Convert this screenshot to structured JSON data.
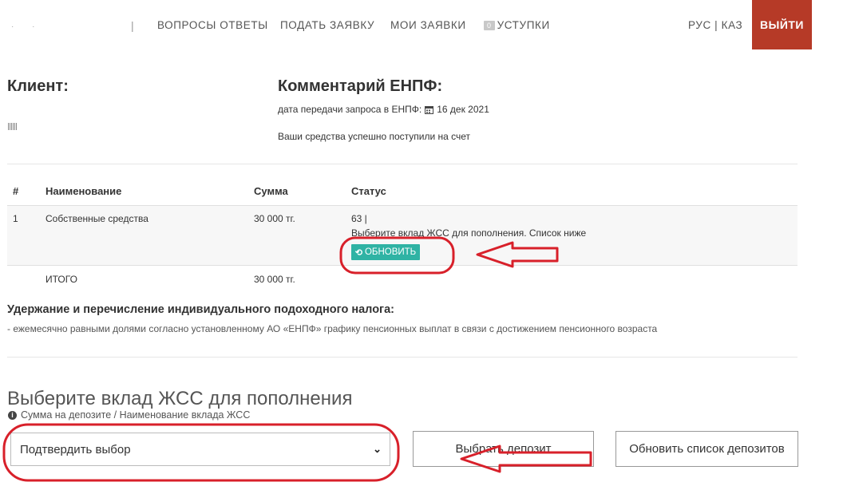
{
  "nav": {
    "separator": "|",
    "items": [
      "ВОПРОСЫ ОТВЕТЫ",
      "ПОДАТЬ ЗАЯВКУ",
      "МОИ ЗАЯВКИ"
    ],
    "cessions_badge": "0",
    "cessions_label": "УСТУПКИ",
    "lang": "РУС | КАЗ",
    "logout": "ВЫЙТИ"
  },
  "client": {
    "title": "Клиент:"
  },
  "comment": {
    "title": "Комментарий ЕНПФ:",
    "date_label": "дата передачи запроса в ЕНПФ:",
    "date_value": "16 дек 2021",
    "message": "Ваши средства успешно поступили на счет"
  },
  "table": {
    "headers": {
      "num": "#",
      "name": "Наименование",
      "sum": "Сумма",
      "status": "Статус"
    },
    "row": {
      "num": "1",
      "name": "Собственные средства",
      "sum": "30 000 тг.",
      "status_code": "63 |",
      "status_text": "Выберите вклад ЖСС для пополнения. Список ниже",
      "refresh_label": "ОБНОВИТЬ"
    },
    "total": {
      "label": "ИТОГО",
      "sum": "30 000 тг."
    }
  },
  "tax": {
    "title": "Удержание и перечисление индивидуального подоходного налога:",
    "text": "- ежемесячно равными долями согласно установленному АО «ЕНПФ» графику пенсионных выплат в связи с достижением пенсионного возраста"
  },
  "deposit": {
    "title": "Выберите вклад ЖСС для пополнения",
    "hint": "Сумма на депозите / Наименование вклада ЖСС",
    "select_value": "Подтвердить выбор",
    "choose_button": "Выбрать депозит",
    "refresh_list_button": "Обновить список депозитов"
  },
  "colors": {
    "logout_bg": "#b63a27",
    "refresh_bg": "#2fb3a4",
    "annotation_red": "#d8202a"
  }
}
